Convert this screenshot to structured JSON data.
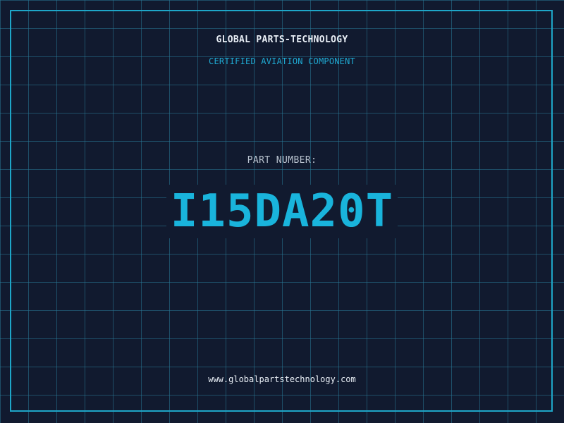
{
  "header": {
    "brand": "GLOBAL PARTS-TECHNOLOGY",
    "subtitle": "CERTIFIED AVIATION COMPONENT"
  },
  "main": {
    "label": "PART NUMBER:",
    "part_number": "I15DA20T"
  },
  "footer": {
    "url": "www.globalpartstechnology.com"
  },
  "colors": {
    "background": "#111a2f",
    "grid": "#28789a",
    "accent": "#19b4dc",
    "border": "#1ea6c8",
    "text": "#e8eef5",
    "muted": "#b9c3cf"
  }
}
